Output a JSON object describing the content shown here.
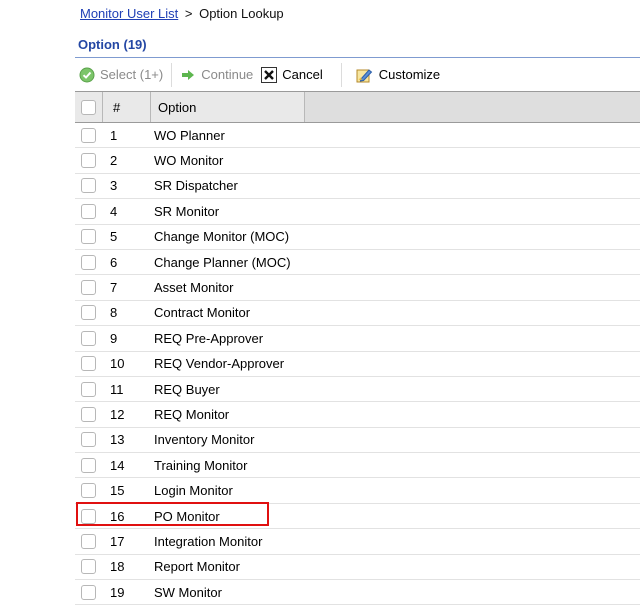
{
  "breadcrumb": {
    "link": "Monitor User List",
    "separator": ">",
    "current": "Option Lookup"
  },
  "section": {
    "title": "Option (19)"
  },
  "toolbar": {
    "select_label": "Select (1+)",
    "continue_label": "Continue",
    "cancel_label": "Cancel",
    "customize_label": "Customize"
  },
  "grid": {
    "columns": {
      "num": "#",
      "option": "Option"
    },
    "rows": [
      {
        "num": "1",
        "option": "WO Planner"
      },
      {
        "num": "2",
        "option": "WO Monitor"
      },
      {
        "num": "3",
        "option": "SR Dispatcher"
      },
      {
        "num": "4",
        "option": "SR Monitor"
      },
      {
        "num": "5",
        "option": "Change Monitor (MOC)"
      },
      {
        "num": "6",
        "option": "Change Planner (MOC)"
      },
      {
        "num": "7",
        "option": "Asset Monitor"
      },
      {
        "num": "8",
        "option": "Contract Monitor"
      },
      {
        "num": "9",
        "option": "REQ Pre-Approver"
      },
      {
        "num": "10",
        "option": "REQ Vendor-Approver"
      },
      {
        "num": "11",
        "option": "REQ Buyer"
      },
      {
        "num": "12",
        "option": "REQ Monitor"
      },
      {
        "num": "13",
        "option": "Inventory Monitor"
      },
      {
        "num": "14",
        "option": "Training Monitor"
      },
      {
        "num": "15",
        "option": "Login Monitor"
      },
      {
        "num": "16",
        "option": "PO Monitor"
      },
      {
        "num": "17",
        "option": "Integration Monitor"
      },
      {
        "num": "18",
        "option": "Report Monitor"
      },
      {
        "num": "19",
        "option": "SW Monitor"
      }
    ]
  },
  "colors": {
    "accent": "#2447a4",
    "link": "#1f3fb5",
    "highlight_border": "#e01010",
    "select_icon": "#6cbf5a",
    "continue_icon": "#56b04a"
  }
}
